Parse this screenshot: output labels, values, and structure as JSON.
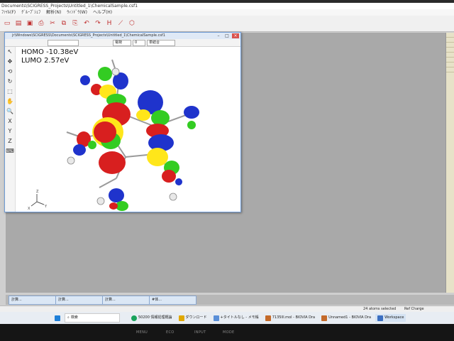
{
  "app": {
    "title": "Documents\\SCIGRESS_Projects\\Untitled_1\\ChemicalSample.csf1",
    "menu": [
      "ﾌｧｲﾙ(F)",
      "ｸﾞﾙｰﾌﾟｼｪﾌ",
      "解析(N)",
      "ｳｨﾝﾄﾞｳ(W)",
      "ヘルプ(H)"
    ]
  },
  "child_window": {
    "title": "jr\\Windows\\SCIGRESS\\Documents\\SCIGRESS_Projects\\Untitled_1\\ChemicalSample.csf1",
    "dropdown_1": "電荷",
    "dropdown_2": "0",
    "dropdown_3": "単結合",
    "left_tools": [
      "↖",
      "✥",
      "⟲",
      "↻",
      "⬚",
      "✋",
      "🔍",
      "X",
      "Y",
      "Z",
      "⌨"
    ]
  },
  "orbitals": {
    "homo": "HOMO -10.38eV",
    "lumo": "LUMO 2.57eV"
  },
  "axes": {
    "x": "X",
    "y": "Y",
    "z": "Z"
  },
  "minimized_windows": [
    "計算...",
    "計算...",
    "計算...",
    "#体..."
  ],
  "statusbar": {
    "selection": "24 atoms selected",
    "mode": "Ref Charge"
  },
  "taskbar": {
    "search": "検索",
    "items": [
      "50200 情報処理概論",
      "ダウンロード",
      "+タイトルなし - メモ帳",
      "7135lll.mol - BIOVIA Dra",
      "Unnamed1 - BIOVIA Dra",
      "Workspace"
    ]
  },
  "bezel": [
    "MENU",
    "ECO",
    "INPUT",
    "MODE"
  ]
}
